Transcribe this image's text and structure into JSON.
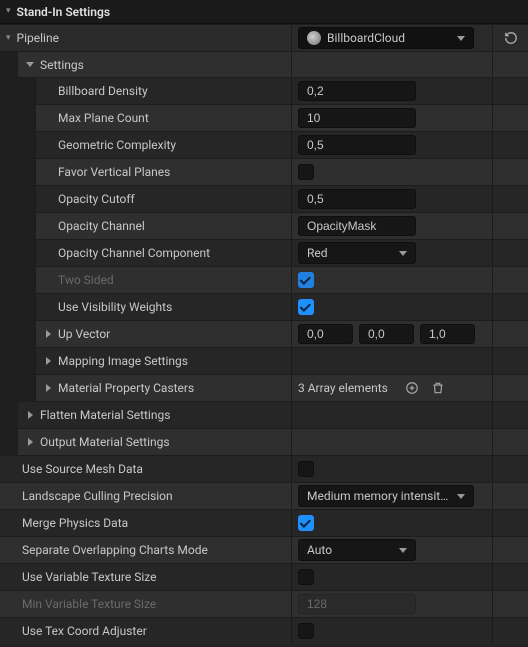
{
  "panelTitle": "Stand-In Settings",
  "pipeline": {
    "label": "Pipeline",
    "value": "BillboardCloud"
  },
  "tree": {
    "settingsLabel": "Settings",
    "props": {
      "billboardDensity": {
        "label": "Billboard Density",
        "value": "0,2"
      },
      "maxPlaneCount": {
        "label": "Max Plane Count",
        "value": "10"
      },
      "geomComplexity": {
        "label": "Geometric Complexity",
        "value": "0,5"
      },
      "favorVertical": {
        "label": "Favor Vertical Planes",
        "checked": false
      },
      "opacityCutoff": {
        "label": "Opacity Cutoff",
        "value": "0,5"
      },
      "opacityChannel": {
        "label": "Opacity Channel",
        "value": "OpacityMask"
      },
      "opacityChannelComp": {
        "label": "Opacity Channel Component",
        "value": "Red"
      },
      "twoSided": {
        "label": "Two Sided",
        "checked": true,
        "disabled": true
      },
      "useVisWeights": {
        "label": "Use Visibility Weights",
        "checked": true
      },
      "upVector": {
        "label": "Up Vector",
        "x": "0,0",
        "y": "0,0",
        "z": "1,0"
      },
      "mappingImage": {
        "label": "Mapping Image Settings"
      },
      "matPropCasters": {
        "label": "Material Property Casters",
        "summary": "3 Array elements"
      }
    },
    "flattenMat": "Flatten Material Settings",
    "outputMat": "Output Material Settings"
  },
  "bottom": {
    "useSourceMesh": {
      "label": "Use Source Mesh Data",
      "checked": false
    },
    "landscapeCulling": {
      "label": "Landscape Culling Precision",
      "value": "Medium memory intensity an"
    },
    "mergePhysics": {
      "label": "Merge Physics Data",
      "checked": true
    },
    "sepOverlap": {
      "label": "Separate Overlapping Charts Mode",
      "value": "Auto"
    },
    "useVarTex": {
      "label": "Use Variable Texture Size",
      "checked": false
    },
    "minVarTex": {
      "label": "Min Variable Texture Size",
      "value": "128",
      "disabled": true
    },
    "useTexCoord": {
      "label": "Use Tex Coord Adjuster",
      "checked": false
    }
  }
}
